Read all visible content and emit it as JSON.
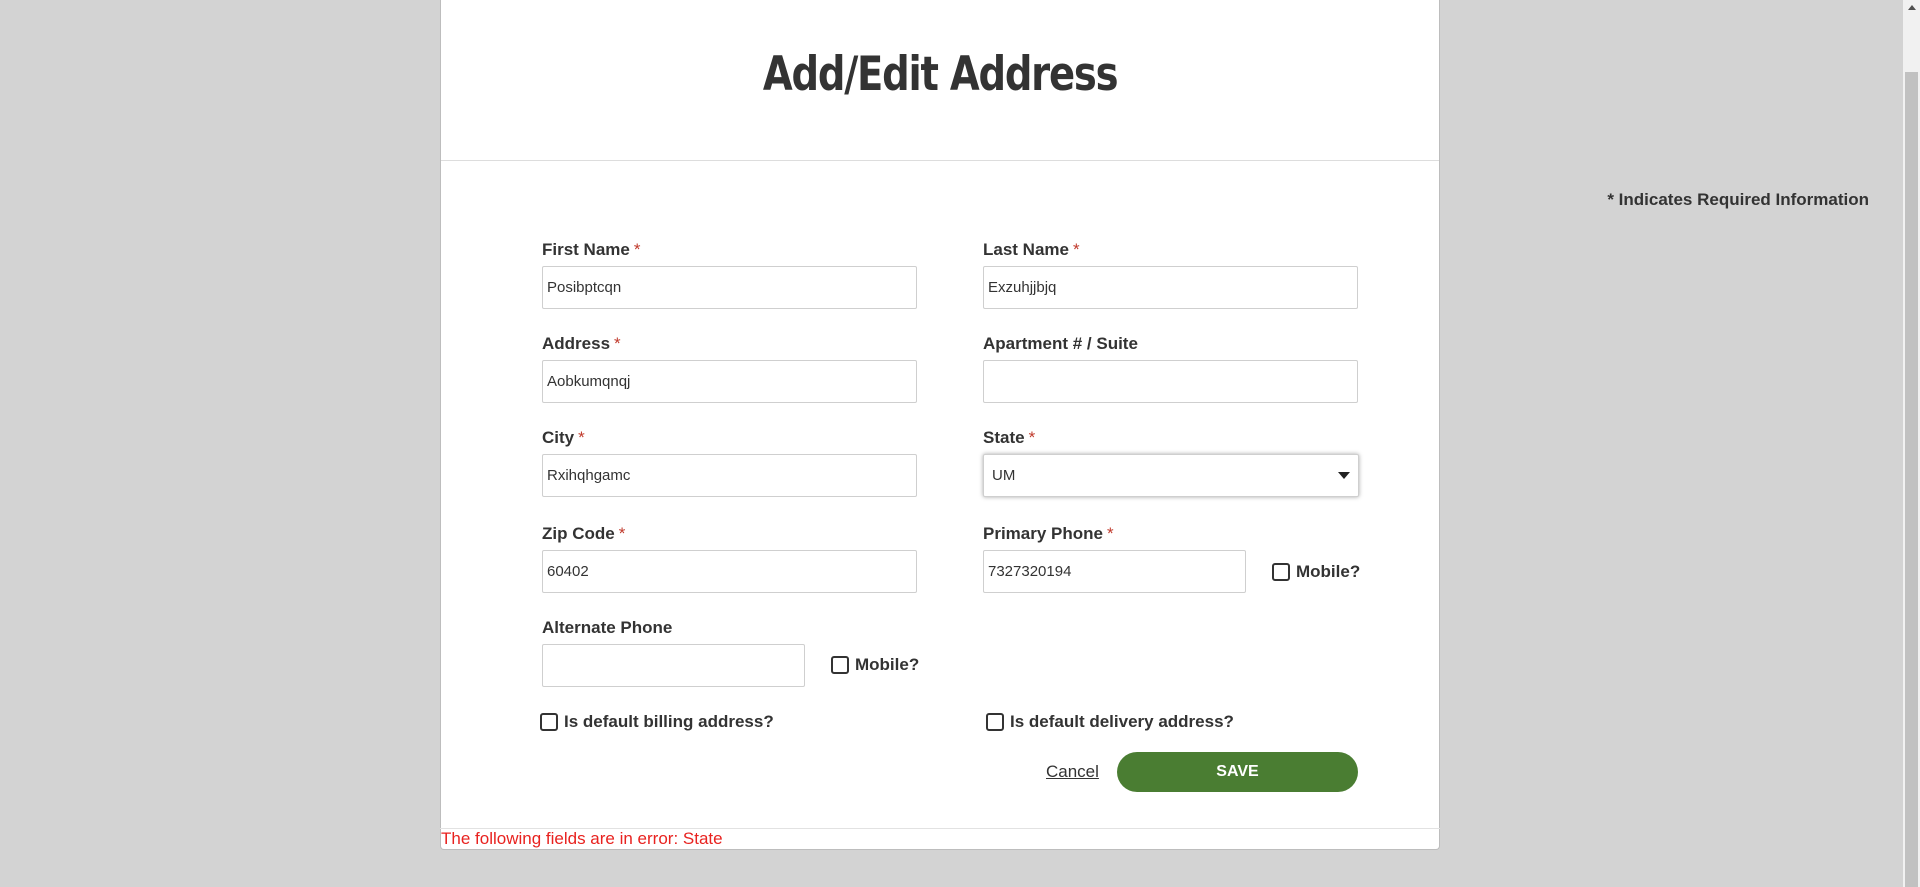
{
  "modal": {
    "title": "Add/Edit Address",
    "required_note": "* Indicates Required Information"
  },
  "form": {
    "first_name": {
      "label": "First Name",
      "required_mark": "*",
      "value": "Posibptcqn"
    },
    "last_name": {
      "label": "Last Name",
      "required_mark": "*",
      "value": "Exzuhjjbjq"
    },
    "address": {
      "label": "Address",
      "required_mark": "*",
      "value": "Aobkumqnqj"
    },
    "apartment": {
      "label": "Apartment # / Suite",
      "value": ""
    },
    "city": {
      "label": "City",
      "required_mark": "*",
      "value": "Rxihqhgamc"
    },
    "state": {
      "label": "State",
      "required_mark": "*",
      "selected": "UM"
    },
    "zip": {
      "label": "Zip Code",
      "required_mark": "*",
      "value": "60402"
    },
    "primary_phone": {
      "label": "Primary Phone",
      "required_mark": "*",
      "value": "7327320194",
      "mobile_label": "Mobile?",
      "mobile_checked": false
    },
    "alternate_phone": {
      "label": "Alternate Phone",
      "value": "",
      "mobile_label": "Mobile?",
      "mobile_checked": false
    },
    "default_billing": {
      "label": "Is default billing address?",
      "checked": false
    },
    "default_delivery": {
      "label": "Is default delivery address?",
      "checked": false
    }
  },
  "actions": {
    "cancel_label": "Cancel",
    "save_label": "SAVE"
  },
  "error": {
    "message": "The following fields are in error: State"
  },
  "colors": {
    "save_button": "#4a7d32",
    "error_text": "#e8221f",
    "required_star": "#c0392b",
    "page_background": "#d3d3d3"
  }
}
